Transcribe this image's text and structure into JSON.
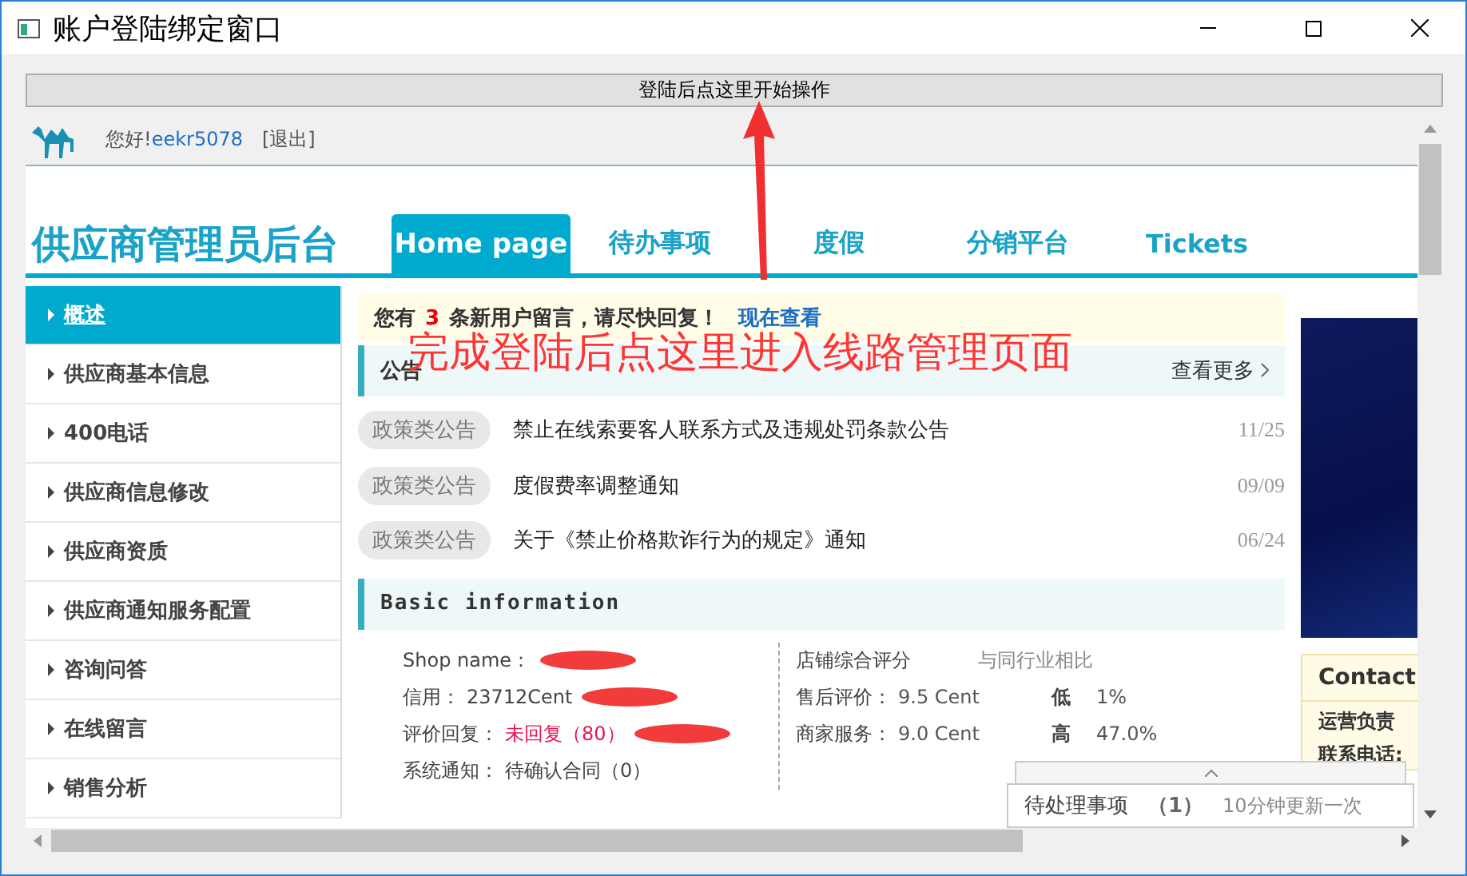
{
  "window": {
    "title": "账户登陆绑定窗口"
  },
  "start_button": "登陆后点这里开始操作",
  "header": {
    "greeting": "您好!",
    "username": "eekr5078",
    "logout": "[退出]"
  },
  "site_title": "供应商管理员后台",
  "tabs": [
    {
      "label": "Home page",
      "selected": true
    },
    {
      "label": "待办事项",
      "selected": false
    },
    {
      "label": "度假",
      "selected": false
    },
    {
      "label": "分销平台",
      "selected": false
    },
    {
      "label": "Tickets",
      "selected": false
    }
  ],
  "sidebar": {
    "items": [
      {
        "label": "概述",
        "selected": true
      },
      {
        "label": "供应商基本信息",
        "selected": false
      },
      {
        "label": "400电话",
        "selected": false
      },
      {
        "label": "供应商信息修改",
        "selected": false
      },
      {
        "label": "供应商资质",
        "selected": false
      },
      {
        "label": "供应商通知服务配置",
        "selected": false
      },
      {
        "label": "咨询问答",
        "selected": false
      },
      {
        "label": "在线留言",
        "selected": false
      },
      {
        "label": "销售分析",
        "selected": false
      }
    ]
  },
  "notice": {
    "prefix": "您有",
    "count": "3",
    "suffix": "条新用户留言，请尽快回复！",
    "link": "现在查看"
  },
  "announcements": {
    "title": "公告",
    "more": "查看更多",
    "items": [
      {
        "tag": "政策类公告",
        "title": "禁止在线索要客人联系方式及违规处罚条款公告",
        "date": "11/25"
      },
      {
        "tag": "政策类公告",
        "title": "度假费率调整通知",
        "date": "09/09"
      },
      {
        "tag": "政策类公告",
        "title": "关于《禁止价格欺诈行为的规定》通知",
        "date": "06/24"
      }
    ]
  },
  "basic_info": {
    "title": "Basic information",
    "left": [
      {
        "label": "Shop name：",
        "redacted": true
      },
      {
        "label": "信用：",
        "value": "23712Cent",
        "highlight": false,
        "redacted": true
      },
      {
        "label": "评价回复：",
        "value": "未回复（80）",
        "highlight": true,
        "redacted": true
      },
      {
        "label": "系统通知：",
        "value": "待确认合同（0）",
        "highlight": false,
        "redacted": false
      }
    ],
    "score_title": "店铺综合评分",
    "compare_title": "与同行业相比",
    "scores": [
      {
        "label": "售后评价：",
        "score": "9.5 Cent",
        "trend": "低",
        "percent": "1%"
      },
      {
        "label": "商家服务：",
        "score": "9.0 Cent",
        "trend": "高",
        "percent": "47.0%"
      }
    ]
  },
  "contact": {
    "title": "Contact",
    "lines": [
      "运营负责",
      "联系电话:"
    ]
  },
  "pending": {
    "label": "待处理事项",
    "count": "（1）",
    "note": "10分钟更新一次"
  },
  "annotation": {
    "text": "完成登陆后点这里进入线路管理页面"
  }
}
